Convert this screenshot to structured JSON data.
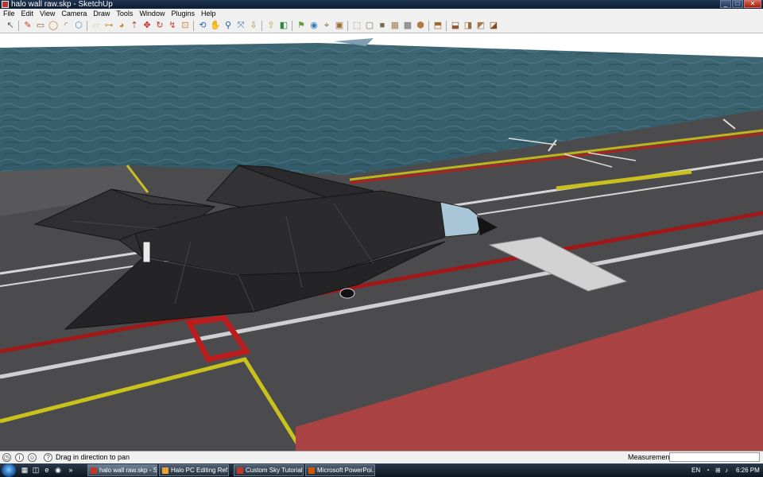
{
  "window": {
    "title": "halo wall raw.skp - SketchUp"
  },
  "menu": [
    "File",
    "Edit",
    "View",
    "Camera",
    "Draw",
    "Tools",
    "Window",
    "Plugins",
    "Help"
  ],
  "toolbar": {
    "tools": [
      {
        "name": "select-tool",
        "glyph": "↖"
      },
      {
        "name": "line-tool",
        "glyph": "✎"
      },
      {
        "name": "rectangle-tool",
        "glyph": "▭"
      },
      {
        "name": "circle-tool",
        "glyph": "◯"
      },
      {
        "name": "arc-tool",
        "glyph": "◜"
      },
      {
        "name": "make-component-tool",
        "glyph": "⬡"
      },
      {
        "name": "eraser-tool",
        "glyph": "▱"
      },
      {
        "name": "tape-measure-tool",
        "glyph": "⊶"
      },
      {
        "name": "paint-bucket-tool",
        "glyph": "◕"
      },
      {
        "name": "push-pull-tool",
        "glyph": "⇡"
      },
      {
        "name": "move-tool",
        "glyph": "✥"
      },
      {
        "name": "rotate-tool",
        "glyph": "↻"
      },
      {
        "name": "follow-me-tool",
        "glyph": "↯"
      },
      {
        "name": "offset-tool",
        "glyph": "⊡"
      },
      {
        "name": "orbit-tool",
        "glyph": "⟲"
      },
      {
        "name": "pan-tool",
        "glyph": "✋"
      },
      {
        "name": "zoom-tool",
        "glyph": "⚲"
      },
      {
        "name": "zoom-extents-tool",
        "glyph": "⤧"
      },
      {
        "name": "get-models-tool",
        "glyph": "⇩"
      },
      {
        "name": "share-model-tool",
        "glyph": "⇧"
      },
      {
        "name": "section-plane-tool",
        "glyph": "◧"
      },
      {
        "name": "walk-tool",
        "glyph": "⚑"
      },
      {
        "name": "look-around-tool",
        "glyph": "◉"
      },
      {
        "name": "position-camera-tool",
        "glyph": "⌖"
      },
      {
        "name": "x-ray-style-tool",
        "glyph": "▣"
      },
      {
        "name": "wireframe-style-tool",
        "glyph": "⬚"
      },
      {
        "name": "hidden-line-style-tool",
        "glyph": "▢"
      },
      {
        "name": "shaded-style-tool",
        "glyph": "■"
      },
      {
        "name": "shaded-textures-style-tool",
        "glyph": "▦"
      },
      {
        "name": "monochrome-style-tool",
        "glyph": "▩"
      },
      {
        "name": "iso-view-tool",
        "glyph": "⬢"
      },
      {
        "name": "top-view-tool",
        "glyph": "⬒"
      },
      {
        "name": "front-view-tool",
        "glyph": "⬓"
      },
      {
        "name": "right-view-tool",
        "glyph": "◨"
      },
      {
        "name": "back-view-tool",
        "glyph": "◩"
      },
      {
        "name": "left-view-tool",
        "glyph": "◪"
      }
    ],
    "colors": [
      "#555",
      "#c83c28",
      "#8b5a2b",
      "#c9803a",
      "#777",
      "#4a90c8",
      "#d6c8a0",
      "#c8a040",
      "#c88a2a",
      "#b04020",
      "#c02020",
      "#c83020",
      "#c84030",
      "#d07a2a",
      "#2a6aa8",
      "#3a7ab8",
      "#1a5a98",
      "#3a6a98",
      "#b08a30",
      "#c09a40",
      "#2a8a3a",
      "#6a9a3a",
      "#3a7ab8",
      "#8a6a4a",
      "#9a6a30",
      "#a07a40",
      "#8a7a5a",
      "#7a6a4a",
      "#a08050",
      "#6a6a6a",
      "#b07a40",
      "#a06a30",
      "#8a5a30",
      "#9a6a40",
      "#a07a50",
      "#8a4a20"
    ]
  },
  "statusbar": {
    "hint": "Drag in direction to pan",
    "measurements_label": "Measurements",
    "measurements_value": ""
  },
  "taskbar": {
    "tasks": [
      {
        "label": "halo wall raw.skp - S...",
        "color": "#c0392b",
        "active": true
      },
      {
        "label": "Halo PC Editing Ref...",
        "color": "#e8a33a",
        "active": false
      },
      {
        "label": "Custom Sky Tutorial...",
        "color": "#c0392b",
        "active": false
      },
      {
        "label": "Microsoft PowerPoi...",
        "color": "#d35400",
        "active": false
      }
    ],
    "tray": {
      "lang": "EN",
      "time": "6:26 PM"
    }
  }
}
